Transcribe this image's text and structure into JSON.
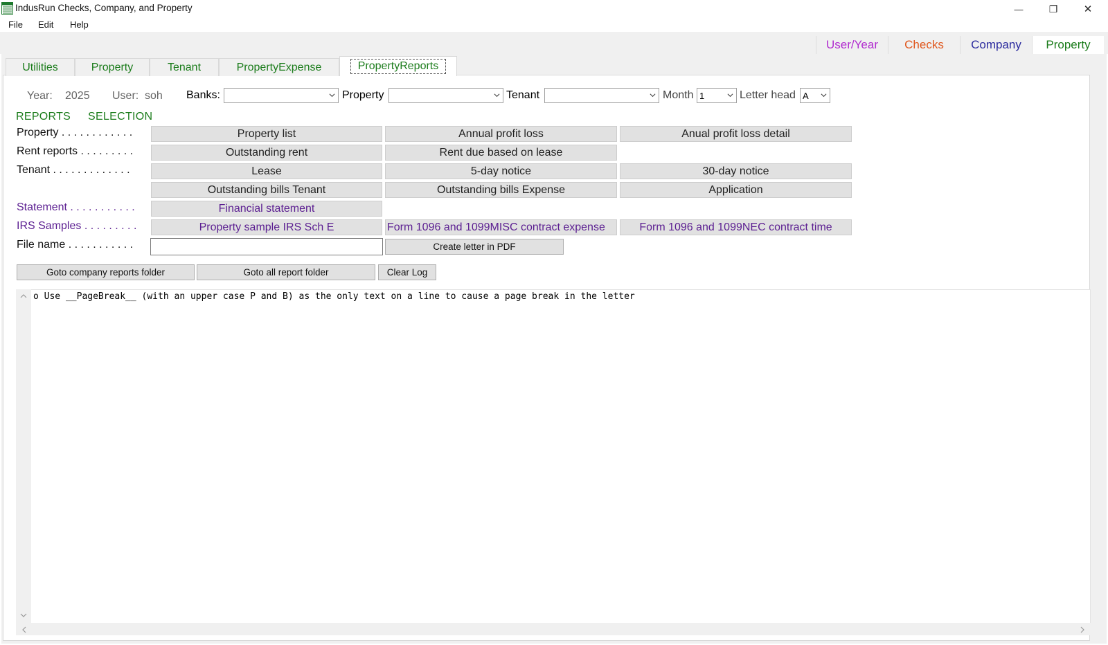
{
  "window": {
    "title": "IndusRun Checks, Company, and Property",
    "minimize_glyph": "—",
    "restore_glyph": "❐",
    "close_glyph": "✕"
  },
  "menu": [
    "File",
    "Edit",
    "Help"
  ],
  "top_tabs": [
    {
      "label": "User/Year",
      "color": "#b12ccf"
    },
    {
      "label": "Checks",
      "color": "#e0561c"
    },
    {
      "label": "Company",
      "color": "#2a2a9e"
    },
    {
      "label": "Property",
      "color": "#1b7c1b"
    }
  ],
  "sub_tabs": [
    "Utilities",
    "Property",
    "Tenant",
    "PropertyExpense",
    "PropertyReports"
  ],
  "filters": {
    "year_label": "Year:",
    "year_value": "2025",
    "user_label": "User:",
    "user_value": "soh",
    "banks_label": "Banks:",
    "banks_value": "",
    "property_label": "Property",
    "property_value": "",
    "tenant_label": "Tenant",
    "tenant_value": "",
    "month_label": "Month",
    "month_value": "1",
    "letterhead_label": "Letter head",
    "letterhead_value": "A"
  },
  "sections": {
    "reports": "REPORTS",
    "selection": "SELECTION"
  },
  "row_labels": {
    "property": "Property . . . . . . . . . . . .",
    "rent": "Rent reports . . . . . . . . .",
    "tenant": "Tenant . . . . . . . . . . . . .",
    "statement": "Statement . . . . . . . . . . .",
    "irs": "IRS Samples . . . . . . . . .",
    "filename": "File name . . . . . . . . . . ."
  },
  "buttons": {
    "property_list": "Property list",
    "annual_profit_loss": "Annual profit loss",
    "anual_profit_loss_detail": "Anual profit loss detail",
    "outstanding_rent": "Outstanding rent",
    "rent_due_lease": "Rent due based on lease",
    "lease": "Lease",
    "five_day_notice": "5-day notice",
    "thirty_day_notice": "30-day notice",
    "outstanding_bills_tenant": "Outstanding bills Tenant",
    "outstanding_bills_expense": "Outstanding bills Expense",
    "application": "Application",
    "financial_statement": "Financial statement",
    "irs_sch_e": "Property sample IRS Sch E",
    "form_1099misc": "Form 1096 and 1099MISC contract expense",
    "form_1099nec": "Form 1096 and 1099NEC contract time",
    "create_letter": "Create letter in PDF",
    "goto_company_folder": "Goto company reports folder",
    "goto_all_folder": "Goto all report folder",
    "clear_log": "Clear Log"
  },
  "file_name_value": "",
  "log_text": "o Use __PageBreak__ (with an upper case P and B) as the only text on a line to cause a page break in the letter",
  "colors": {
    "green": "#1b7c1b",
    "purple": "#5b1e91",
    "button_bg": "#e1e1e1",
    "panel_bg": "#f0f0f0"
  }
}
